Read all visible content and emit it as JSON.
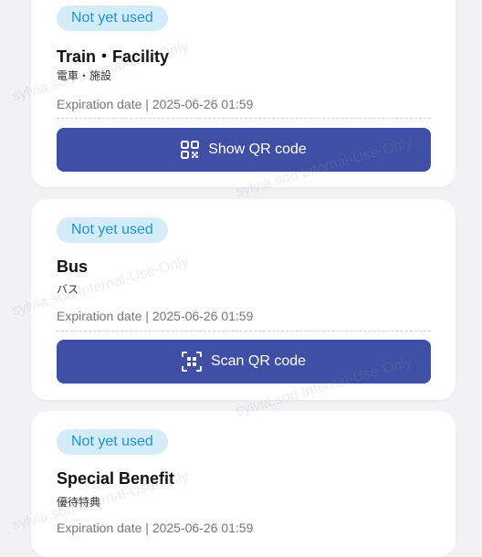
{
  "tickets": [
    {
      "status": "Not yet used",
      "title": "Train・Facility",
      "subtitle": "電車・施設",
      "expiration_label": "Expiration date",
      "expiration_separator": " | ",
      "expiration_date": "2025-06-26 01:59",
      "action_label": "Show QR code",
      "action_icon": "qr-code-icon"
    },
    {
      "status": "Not yet used",
      "title": "Bus",
      "subtitle": "バス",
      "expiration_label": "Expiration date",
      "expiration_separator": " | ",
      "expiration_date": "2025-06-26 01:59",
      "action_label": "Scan QR code",
      "action_icon": "scan-qr-icon"
    },
    {
      "status": "Not yet used",
      "title": "Special Benefit",
      "subtitle": "優待特典",
      "expiration_label": "Expiration date",
      "expiration_separator": " | ",
      "expiration_date": "2025-06-26 01:59"
    }
  ],
  "watermark": "sylvia.soo Internal-Use-Only",
  "colors": {
    "badge_bg": "#d3ecf8",
    "badge_text": "#1d97d6",
    "button_bg": "#3f4fa6",
    "page_bg": "#f2f2f5"
  }
}
